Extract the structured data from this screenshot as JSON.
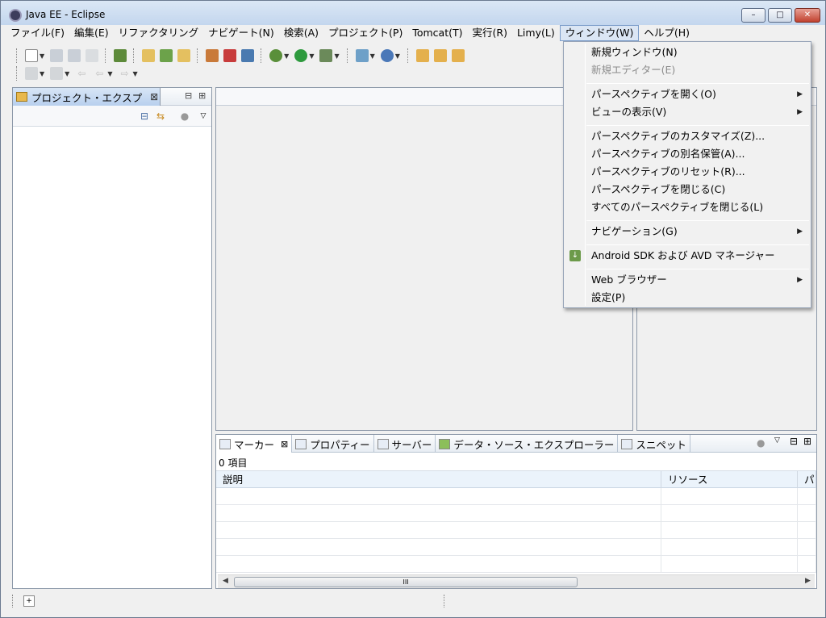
{
  "window": {
    "title": "Java EE - Eclipse",
    "min": "–",
    "max": "□",
    "close": "✕"
  },
  "menubar": [
    "ファイル(F)",
    "編集(E)",
    "リファクタリング",
    "ナビゲート(N)",
    "検索(A)",
    "プロジェクト(P)",
    "Tomcat(T)",
    "実行(R)",
    "Limy(L)",
    "ウィンドウ(W)",
    "ヘルプ(H)"
  ],
  "project_view": {
    "tab_label": "プロジェクト・エクスプ",
    "close": "⊠",
    "minimize": "⊟",
    "maximize": "⊞"
  },
  "bottom": {
    "tabs": [
      "マーカー",
      "プロパティー",
      "サーバー",
      "データ・ソース・エクスプローラー",
      "スニペット"
    ],
    "item_count": "0 項目",
    "columns": [
      "説明",
      "リソース",
      "パ"
    ],
    "scroll_thumb": "III"
  },
  "window_menu": {
    "items": [
      {
        "label": "新規ウィンドウ(N)"
      },
      {
        "label": "新規エディター(E)"
      },
      {
        "label": "パースペクティブを開く(O)"
      },
      {
        "label": "ビューの表示(V)"
      },
      {
        "label": "パースペクティブのカスタマイズ(Z)..."
      },
      {
        "label": "パースペクティブの別名保管(A)..."
      },
      {
        "label": "パースペクティブのリセット(R)..."
      },
      {
        "label": "パースペクティブを閉じる(C)"
      },
      {
        "label": "すべてのパースペクティブを閉じる(L)"
      },
      {
        "label": "ナビゲーション(G)"
      },
      {
        "label": "Android SDK および AVD マネージャー"
      },
      {
        "label": "Web ブラウザー"
      },
      {
        "label": "設定(P)"
      }
    ],
    "submenu_arrow": "▶"
  }
}
